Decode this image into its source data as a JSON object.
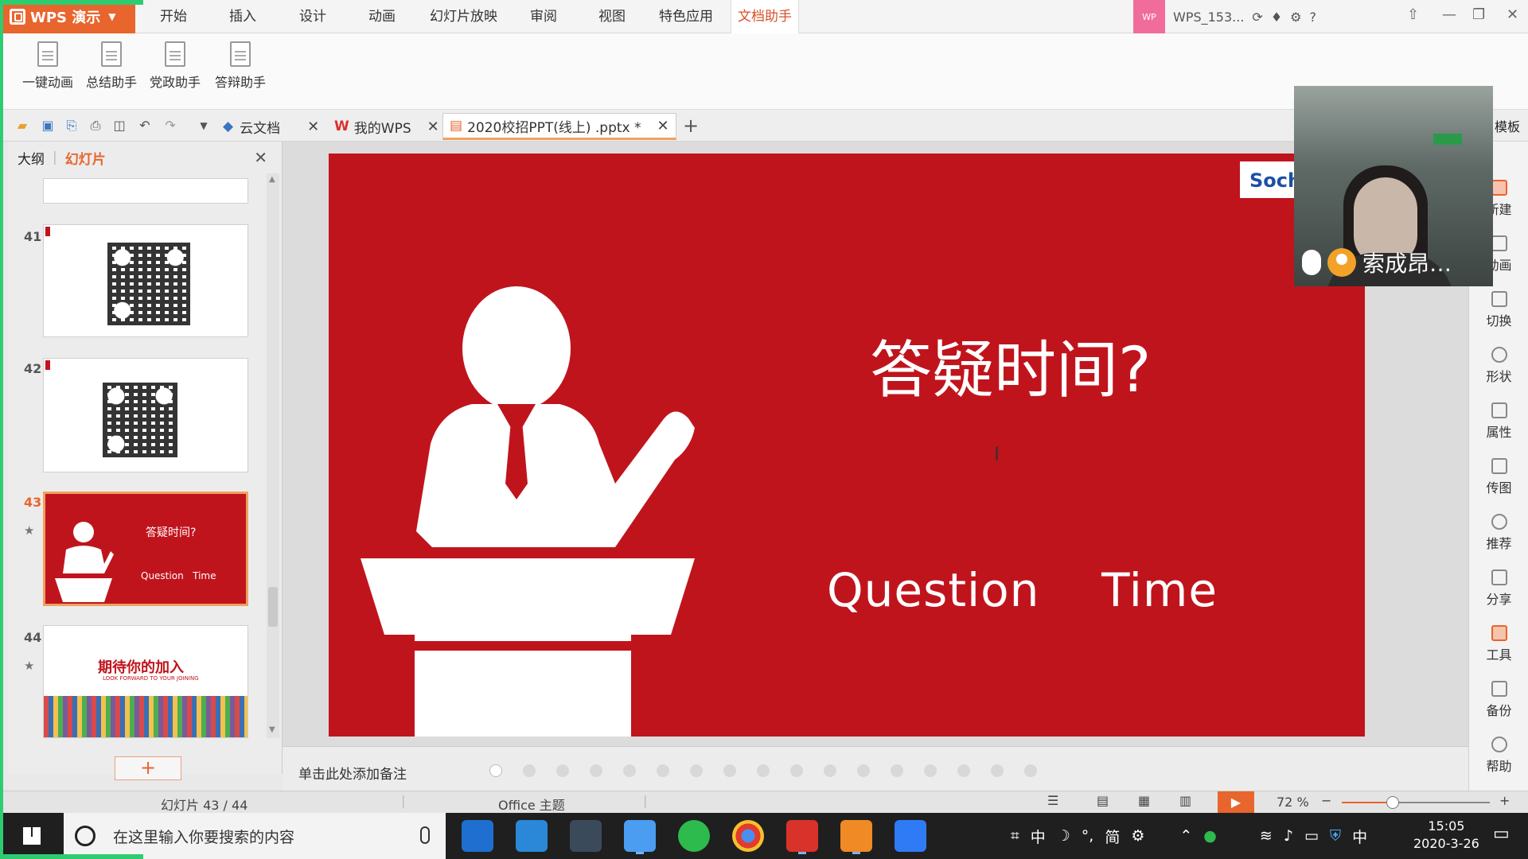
{
  "app": {
    "name": "WPS 演示"
  },
  "menu": [
    "开始",
    "插入",
    "设计",
    "动画",
    "幻灯片放映",
    "审阅",
    "视图",
    "特色应用",
    "文档助手"
  ],
  "account": {
    "badge": "WP",
    "name": "WPS_153..."
  },
  "ribbon": {
    "buttons": [
      "一键动画",
      "总结助手",
      "党政助手",
      "答辩助手"
    ]
  },
  "tabs": {
    "cloud": "云文档",
    "mywps": "我的WPS",
    "doc": "2020校招PPT(线上) .pptx *",
    "more_templates": "模板"
  },
  "panel": {
    "tab_outline": "大纲",
    "tab_slides": "幻灯片",
    "slide_numbers": [
      "41",
      "42",
      "43",
      "44"
    ],
    "thumb43": {
      "title": "答疑时间?",
      "subtitle": "Question   Time"
    },
    "thumb44": {
      "title": "期待你的加入",
      "subtitle": "LOOK FORWARD TO YOUR JOINING"
    }
  },
  "slide": {
    "title": "答疑时间?",
    "subtitle": "Question    Time",
    "logo": "Soch"
  },
  "notes": {
    "placeholder": "单击此处添加备注"
  },
  "status": {
    "slide_count": "幻灯片 43 / 44",
    "theme": "Office 主题",
    "zoom": "72 %"
  },
  "right_panel": [
    "新建",
    "动画",
    "切换",
    "形状",
    "属性",
    "传图",
    "推荐",
    "分享",
    "工具",
    "备份",
    "帮助"
  ],
  "webcam": {
    "name": "索成昂…"
  },
  "taskbar": {
    "search_placeholder": "在这里输入你要搜索的内容",
    "time": "15:05",
    "date": "2020-3-26",
    "ime": "中",
    "ime_mode": "简"
  }
}
